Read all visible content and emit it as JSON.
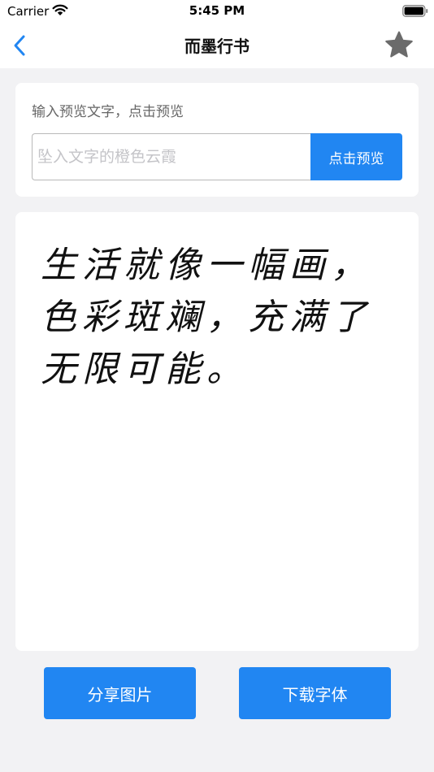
{
  "status_bar": {
    "carrier": "Carrier",
    "time": "5:45 PM"
  },
  "nav": {
    "title": "而墨行书",
    "back_icon": "chevron-left-icon",
    "favorite_icon": "star-icon"
  },
  "input_card": {
    "hint": "输入预览文字，点击预览",
    "placeholder": "坠入文字的橙色云霞",
    "value": "",
    "preview_button_label": "点击预览"
  },
  "preview": {
    "text": "生活就像一幅画，色彩斑斓，充满了无限可能。"
  },
  "actions": {
    "share_label": "分享图片",
    "download_label": "下载字体"
  },
  "colors": {
    "accent": "#2186f2",
    "background": "#f2f2f4",
    "card": "#ffffff",
    "icon_gray": "#6b6b6b"
  }
}
